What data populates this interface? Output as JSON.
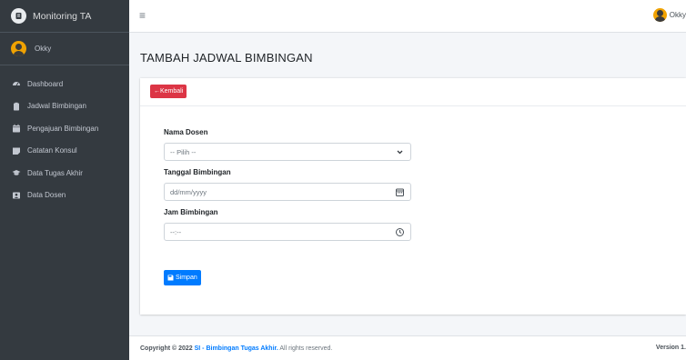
{
  "brand": {
    "title": "Monitoring TA",
    "logo_letter": ""
  },
  "user": {
    "name": "Okky"
  },
  "sidebar": {
    "items": [
      {
        "label": "Dashboard",
        "icon": "dashboard-icon"
      },
      {
        "label": "Jadwal Bimbingan",
        "icon": "clipboard-icon"
      },
      {
        "label": "Pengajuan Bimbingan",
        "icon": "calendar-icon"
      },
      {
        "label": "Catatan Konsul",
        "icon": "note-icon"
      },
      {
        "label": "Data Tugas Akhir",
        "icon": "graduation-cap-icon"
      },
      {
        "label": "Data Dosen",
        "icon": "id-card-icon"
      }
    ]
  },
  "navbar": {
    "menu_icon": "≡",
    "user_name": "Okky"
  },
  "page": {
    "title": "TAMBAH JADWAL BIMBINGAN"
  },
  "card": {
    "back_label": "Kembali",
    "back_arrow": "←"
  },
  "form": {
    "dosen_label": "Nama Dosen",
    "dosen_value": "-- Pilih --",
    "tanggal_label": "Tanggal Bimbingan",
    "tanggal_placeholder": "dd/mm/yyyy",
    "jam_label": "Jam Bimbingan",
    "jam_placeholder": "--:--",
    "save_label": "Simpan"
  },
  "footer": {
    "copyright_prefix": "Copyright © 2022 ",
    "link_text": "SI - Bimbingan Tugas Akhir.",
    "suffix": " All rights reserved.",
    "version": "Version 1."
  },
  "colors": {
    "sidebar": "#343a40",
    "danger": "#dc3545",
    "primary": "#007bff"
  }
}
